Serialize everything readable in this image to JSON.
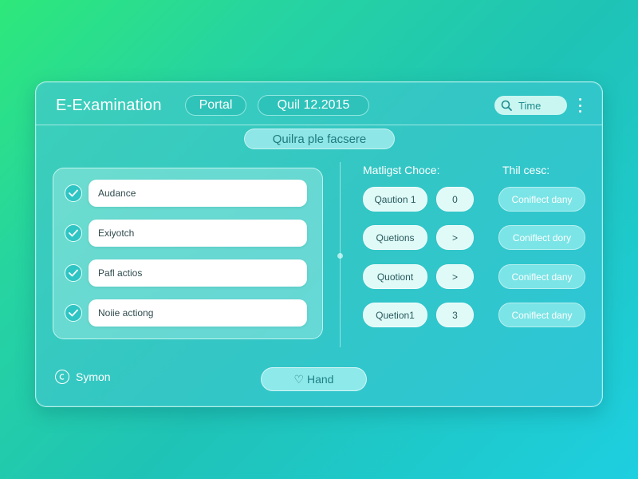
{
  "header": {
    "title": "E-Examination",
    "portal_label": "Portal",
    "date_label": "Quil 12.2015",
    "time_button": "Time",
    "time_icon": "search-icon",
    "menu_icon": "kebab-menu-icon"
  },
  "subtitle": "Quilra ple facsere",
  "options": [
    {
      "label": "Audance",
      "checked": true
    },
    {
      "label": "Exiyotch",
      "checked": true
    },
    {
      "label": "Pafl actios",
      "checked": true
    },
    {
      "label": "Noiie actiong",
      "checked": true
    }
  ],
  "columns": {
    "multiple_choice": "Matligst Choce:",
    "third": "Thil cesc:"
  },
  "questions": [
    {
      "question": "Qaution 1",
      "value": "0",
      "status": "Coniflect dany"
    },
    {
      "question": "Quetions",
      "value": ">",
      "status": "Coniflect dory"
    },
    {
      "question": "Quotiont",
      "value": ">",
      "status": "Coniflect dany"
    },
    {
      "question": "Quetion1",
      "value": "3",
      "status": "Coniflect dany"
    }
  ],
  "footer": {
    "symbol_label": "Symon",
    "symbol_icon": "circle-icon",
    "hand_button": "♡ Hand"
  },
  "colors": {
    "accent": "#2ec5c4",
    "panel": "#3ccfba",
    "light_pill": "#dffaf7"
  }
}
